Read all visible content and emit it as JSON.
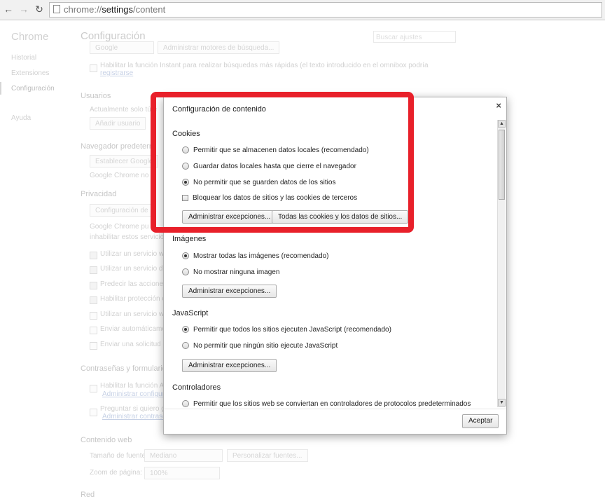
{
  "toolbar": {
    "back": "←",
    "forward": "→",
    "reload": "↻",
    "url_scheme": "chrome://",
    "url_host": "settings",
    "url_path": "/content"
  },
  "sidebar": {
    "title": "Chrome",
    "items": [
      "Historial",
      "Extensiones",
      "Configuración",
      "Ayuda"
    ]
  },
  "settings_bg": {
    "title": "Configuración",
    "search_placeholder": "Buscar ajustes",
    "search_engine_value": "Google",
    "manage_engines": "Administrar motores de búsqueda...",
    "instant_text": "Habilitar la función Instant para realizar búsquedas más rápidas (el texto introducido en el omnibox podría",
    "instant_link": "registrarse",
    "users_heading": "Usuarios",
    "users_text": "Actualmente solo tú e",
    "add_user": "Añadir usuario",
    "default_browser_heading": "Navegador predeterm",
    "default_browser_btn": "Establecer Google",
    "default_browser_text": "Google Chrome no e",
    "privacy_heading": "Privacidad",
    "content_settings_btn": "Configuración de",
    "privacy_text1": "Google Chrome pu",
    "privacy_text2": "inhabilitar estos servicios s",
    "privacy_checks": [
      "Utilizar un servicio web",
      "Utilizar un servicio de p",
      "Predecir las acciones d",
      "Habilitar protección co",
      "Utilizar un servicio web",
      "Enviar automáticamen",
      "Enviar una solicitud de"
    ],
    "passwords_heading": "Contraseñas y formularios",
    "autofill_text": "Habilitar la función Aut",
    "autofill_link": "Administrar configura",
    "passwords_text": "Preguntar si quiero gu",
    "passwords_link": "Administrar contrasef",
    "web_content_heading": "Contenido web",
    "font_size_label": "Tamaño de fuente:",
    "font_size_value": "Mediano",
    "customize_fonts": "Personalizar fuentes...",
    "zoom_label": "Zoom de página:",
    "zoom_value": "100%",
    "network_heading": "Red"
  },
  "dialog": {
    "title": "Configuración de contenido",
    "close": "×",
    "cookies": {
      "heading": "Cookies",
      "options": [
        "Permitir que se almacenen datos locales (recomendado)",
        "Guardar datos locales hasta que cierre el navegador",
        "No permitir que se guarden datos de los sitios"
      ],
      "selected_index": 2,
      "block_third_party": "Bloquear los datos de sitios y las cookies de terceros",
      "manage_exceptions": "Administrar excepciones...",
      "all_cookies": "Todas las cookies y los datos de sitios..."
    },
    "images": {
      "heading": "Imágenes",
      "options": [
        "Mostrar todas las imágenes (recomendado)",
        "No mostrar ninguna imagen"
      ],
      "manage_exceptions": "Administrar excepciones..."
    },
    "javascript": {
      "heading": "JavaScript",
      "options": [
        "Permitir que todos los sitios ejecuten JavaScript (recomendado)",
        "No permitir que ningún sitio ejecute JavaScript"
      ],
      "manage_exceptions": "Administrar excepciones..."
    },
    "handlers": {
      "heading": "Controladores",
      "options": [
        "Permitir que los sitios web se conviertan en controladores de protocolos predeterminados"
      ]
    },
    "accept": "Aceptar"
  },
  "colors": {
    "highlight": "#e8202a"
  }
}
